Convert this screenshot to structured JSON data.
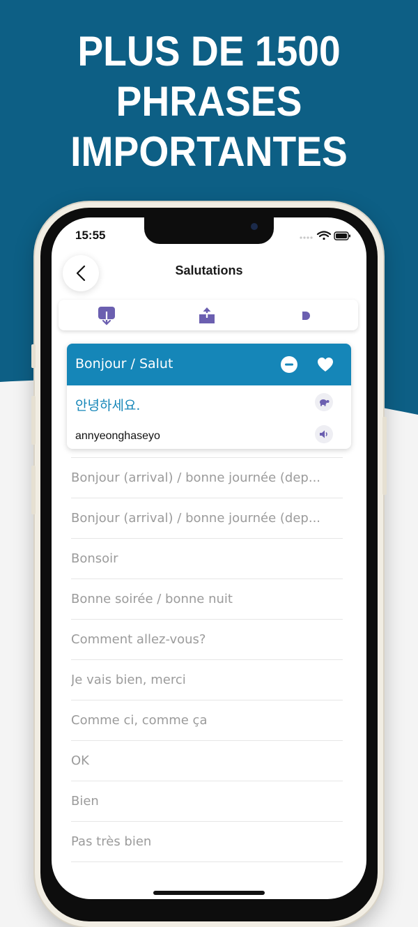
{
  "headline": [
    "PLUS DE 1500",
    "PHRASES",
    "IMPORTANTES"
  ],
  "colors": {
    "banner": "#0d5f85",
    "accent": "#1586b8",
    "icon_purple": "#6b5fb0",
    "muted_text": "#9b9b9b"
  },
  "status_bar": {
    "time": "15:55"
  },
  "header": {
    "title": "Salutations",
    "back_icon": "chevron-left-icon"
  },
  "toolbar": {
    "items": [
      {
        "icon": "download-icon"
      },
      {
        "icon": "share-icon"
      },
      {
        "icon": "play-icon"
      }
    ]
  },
  "selected_phrase": {
    "label": "Bonjour / Salut",
    "translation": "안녕하세요.",
    "romanization": "annyeonghaseyo",
    "icons": [
      "remove-icon",
      "heart-icon",
      "turtle-icon",
      "speaker-icon"
    ]
  },
  "phrases": [
    "Bonjour (arrival) / bonne journée (dep...",
    "Bonjour (arrival) / bonne journée (dep...",
    "Bonsoir",
    "Bonne soirée / bonne nuit",
    "Comment allez-vous?",
    "Je vais bien, merci",
    "Comme ci, comme ça",
    "OK",
    "Bien",
    "Pas très bien"
  ]
}
